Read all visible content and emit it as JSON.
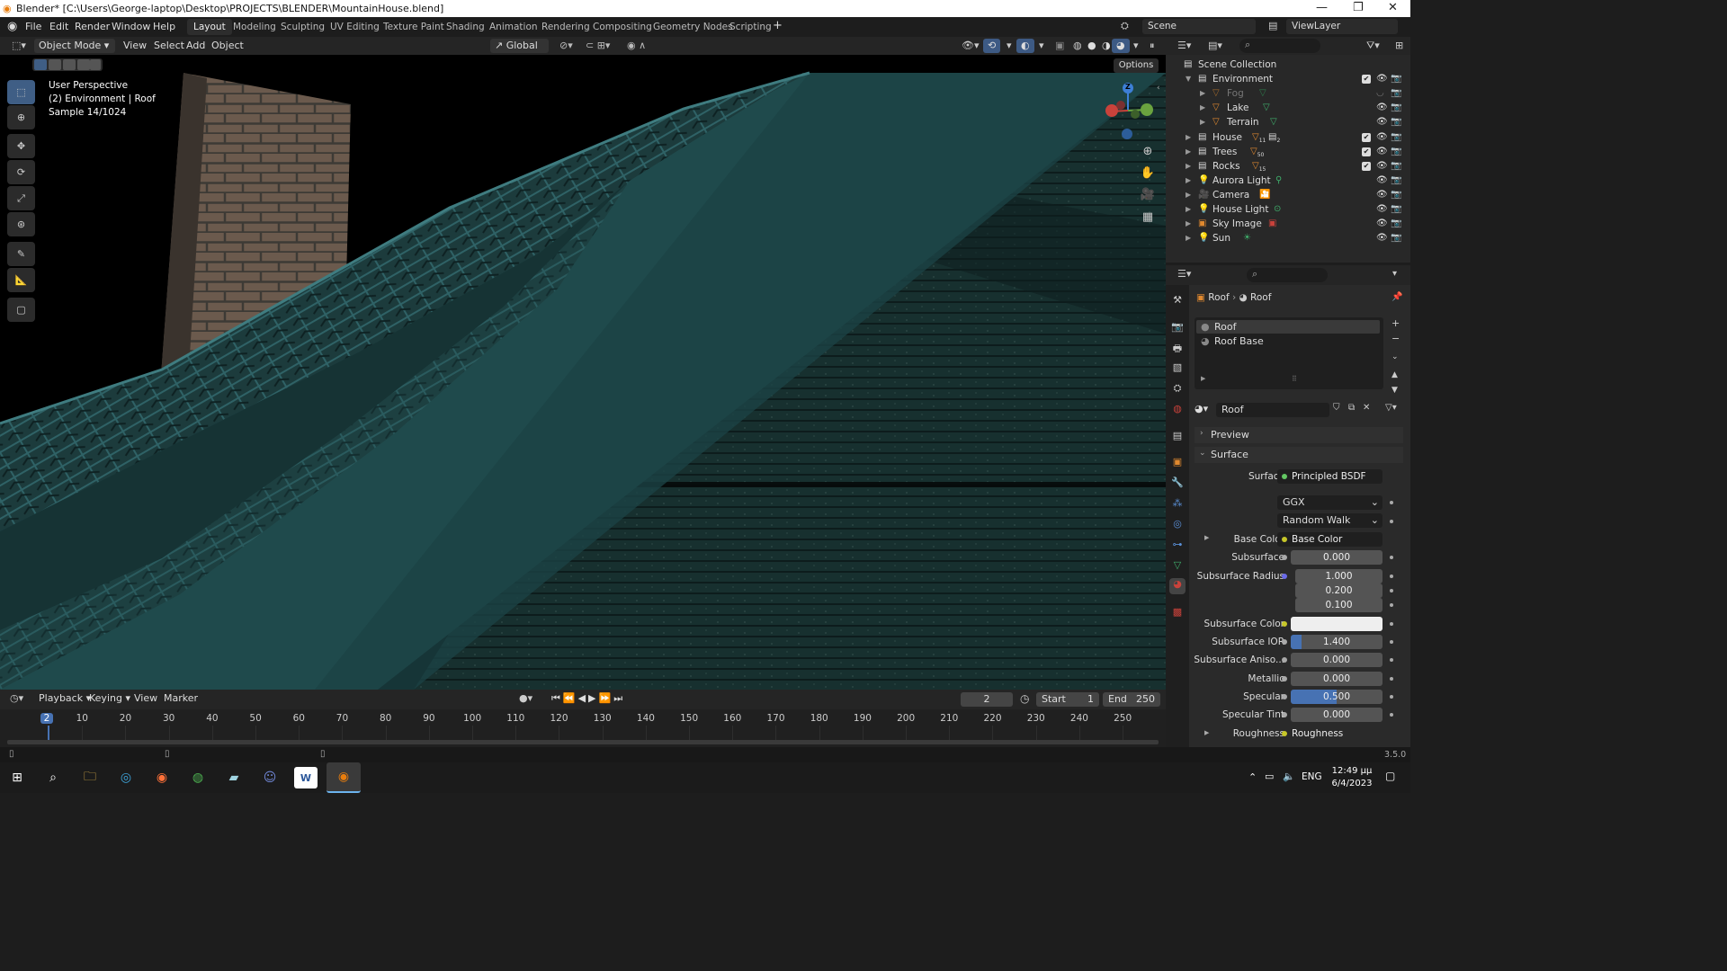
{
  "titlebar": {
    "title": "Blender* [C:\\Users\\George-laptop\\Desktop\\PROJECTS\\BLENDER\\MountainHouse.blend]",
    "minimize": "—",
    "maximize": "❐",
    "close": "✕"
  },
  "menu": {
    "items": [
      "File",
      "Edit",
      "Render",
      "Window",
      "Help"
    ],
    "workspaces": [
      "Layout",
      "Modeling",
      "Sculpting",
      "UV Editing",
      "Texture Paint",
      "Shading",
      "Animation",
      "Rendering",
      "Compositing",
      "Geometry Nodes",
      "Scripting"
    ],
    "add_workspace": "+",
    "scene": "Scene",
    "view_layer": "ViewLayer"
  },
  "viewport_header": {
    "mode": "Object Mode",
    "menus": [
      "View",
      "Select",
      "Add",
      "Object"
    ],
    "orientation": "Global",
    "options": "Options"
  },
  "viewport": {
    "perspective": "User Perspective",
    "context": "(2) Environment | Roof",
    "sample": "Sample 14/1024",
    "gizmo_z": "Z"
  },
  "outliner": {
    "root": "Scene Collection",
    "rows": [
      {
        "label": "Environment",
        "type": "collection"
      },
      {
        "label": "Fog",
        "type": "mesh"
      },
      {
        "label": "Lake",
        "type": "mesh"
      },
      {
        "label": "Terrain",
        "type": "mesh"
      },
      {
        "label": "House",
        "type": "collection"
      },
      {
        "label": "Trees",
        "type": "collection"
      },
      {
        "label": "Rocks",
        "type": "collection"
      },
      {
        "label": "Aurora Light",
        "type": "light"
      },
      {
        "label": "Camera",
        "type": "camera"
      },
      {
        "label": "House Light",
        "type": "light"
      },
      {
        "label": "Sky Image",
        "type": "image"
      },
      {
        "label": "Sun",
        "type": "light"
      }
    ],
    "house_count_1": "11",
    "house_count_2": "2",
    "trees_count": "50",
    "rocks_count": "15"
  },
  "properties": {
    "breadcrumb_object": "Roof",
    "breadcrumb_material": "Roof",
    "slots": [
      "Roof",
      "Roof Base"
    ],
    "material_name": "Roof",
    "panel_preview": "Preview",
    "panel_surface": "Surface",
    "surface_label": "Surface",
    "surface_shader": "Principled BSDF",
    "distribution": "GGX",
    "subsurface_method": "Random Walk",
    "base_color_label": "Base Color",
    "base_color_link": "Base Color",
    "subsurface_label": "Subsurface",
    "subsurface_value": "0.000",
    "subsurface_radius_label": "Subsurface Radius",
    "subsurface_radius": [
      "1.000",
      "0.200",
      "0.100"
    ],
    "subsurface_color_label": "Subsurface Color",
    "subsurface_ior_label": "Subsurface IOR",
    "subsurface_ior_value": "1.400",
    "subsurface_aniso_label": "Subsurface Aniso...",
    "subsurface_aniso_value": "0.000",
    "metallic_label": "Metallic",
    "metallic_value": "0.000",
    "specular_label": "Specular",
    "specular_value": "0.500",
    "specular_tint_label": "Specular Tint",
    "specular_tint_value": "0.000",
    "roughness_label": "Roughness",
    "roughness_link": "Roughness"
  },
  "timeline": {
    "menus": [
      "Playback",
      "Keying",
      "View",
      "Marker"
    ],
    "current_frame": "2",
    "start_label": "Start",
    "start": "1",
    "end_label": "End",
    "end": "250",
    "ruler": [
      "2",
      "10",
      "20",
      "30",
      "40",
      "50",
      "60",
      "70",
      "80",
      "90",
      "100",
      "110",
      "120",
      "130",
      "140",
      "150",
      "160",
      "170",
      "180",
      "190",
      "200",
      "210",
      "220",
      "230",
      "240",
      "250"
    ]
  },
  "status": {
    "version": "3.5.0"
  },
  "taskbar": {
    "lang": "ENG",
    "time": "12:49 μμ",
    "date": "6/4/2023"
  },
  "colors": {
    "accent": "#4772b3",
    "roof_teal": "#1f4a4c",
    "wall_teal": "#15302f",
    "brick": "#6b5a4d"
  }
}
